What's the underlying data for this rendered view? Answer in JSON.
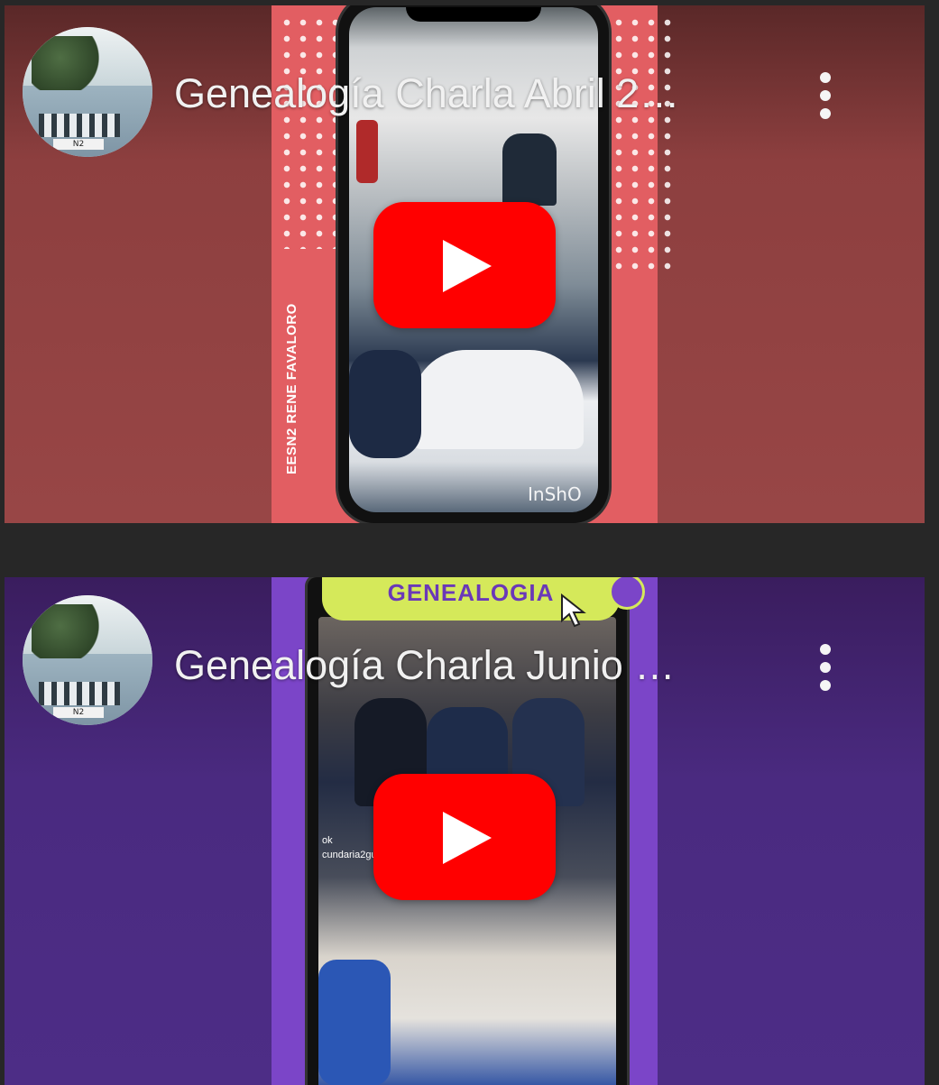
{
  "videos": [
    {
      "title": "Genealogía Charla Abril 2…",
      "channel_overlay": "EESN2 RENE FAVALORO",
      "avatar_sign": "N2",
      "watermark": "InShO",
      "colors": {
        "background": "#8d3f3f",
        "panel": "#e25e62"
      }
    },
    {
      "title": "Genealogía Charla Junio …",
      "banner": "GENEALOGIA",
      "avatar_sign": "N2",
      "handle_a": "ok",
      "handle_b": "cundaria2gu",
      "colors": {
        "background": "#4a2a80",
        "panel": "#7b45c8"
      }
    }
  ],
  "icons": {
    "more": "more-vert-icon",
    "play": "youtube-play-icon",
    "cursor": "cursor-icon",
    "search": "search-icon"
  }
}
